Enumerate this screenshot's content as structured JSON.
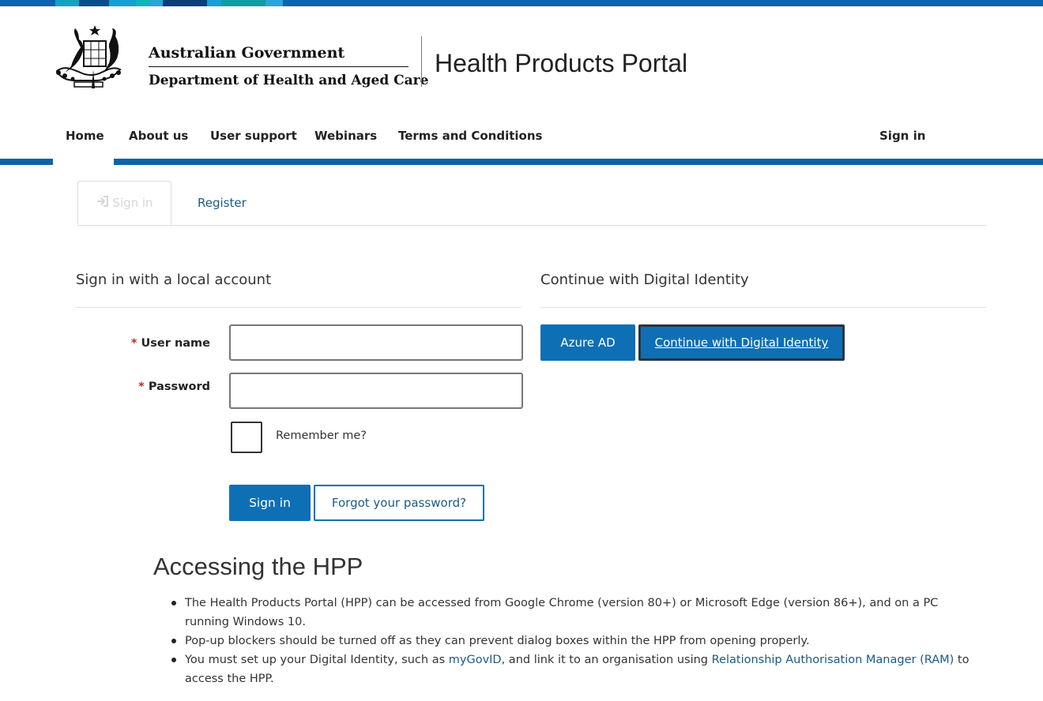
{
  "header": {
    "gov_name": "Australian Government",
    "dept_name": "Department of Health and Aged Care",
    "portal_title": "Health Products Portal"
  },
  "nav": {
    "home": "Home",
    "about": "About us",
    "support": "User support",
    "webinars": "Webinars",
    "terms": "Terms and Conditions",
    "sign_in": "Sign in"
  },
  "tabs": {
    "sign_in": "Sign in",
    "register": "Register"
  },
  "local": {
    "heading": "Sign in with a local account",
    "required_mark": "*",
    "username_label": "User name",
    "username_value": "",
    "password_label": "Password",
    "password_value": "",
    "remember_label": "Remember me?",
    "sign_in_button": "Sign in",
    "forgot_button": "Forgot your password?"
  },
  "digital": {
    "heading": "Continue with Digital Identity",
    "azure_button": "Azure AD",
    "digital_button": "Continue with Digital Identity"
  },
  "info": {
    "heading": "Accessing the HPP",
    "item1": "The Health Products Portal (HPP) can be accessed from Google Chrome (version 80+) or Microsoft Edge (version 86+), and on a PC running Windows 10.",
    "item2": "Pop-up blockers should be turned off as they can prevent dialog boxes within the HPP from opening properly.",
    "item3_a": "You must set up your Digital Identity, such as ",
    "item3_link1": "myGovID",
    "item3_b": ", and link it to an organisation using ",
    "item3_link2": "Relationship Authorisation Manager (RAM)",
    "item3_c": " to access the HPP."
  },
  "icons": {
    "crest": "coat-of-arms-icon",
    "sign_in_tab": "sign-in-icon"
  },
  "colors": {
    "brand_blue": "#0f63a8",
    "button_blue": "#0f6fb5",
    "link_blue": "#1c5a85",
    "required_red": "#b62d2d"
  }
}
